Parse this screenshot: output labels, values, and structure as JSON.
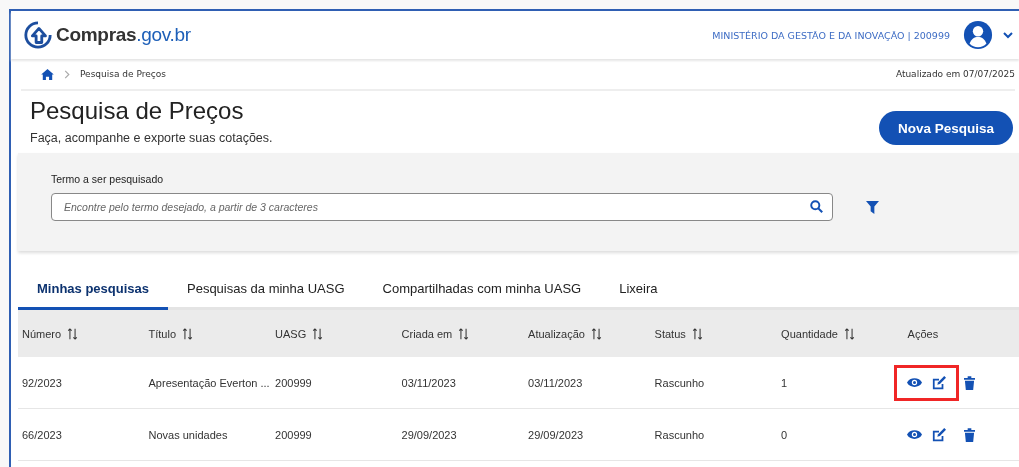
{
  "header": {
    "logo": {
      "name": "Compras",
      "suffix": ".gov.br"
    },
    "organization": "MINISTÉRIO DA GESTÃO E DA INOVAÇÃO | 200999"
  },
  "breadcrumb": {
    "items": [
      "Pesquisa de Preços"
    ],
    "updated": "Atualizado em 07/07/2025"
  },
  "page": {
    "title": "Pesquisa de Preços",
    "subtitle": "Faça, acompanhe e exporte suas cotações.",
    "primary_button": "Nova Pesquisa"
  },
  "search": {
    "label": "Termo a ser pesquisado",
    "placeholder": "Encontre pelo termo desejado, a partir de 3 caracteres"
  },
  "tabs": [
    {
      "label": "Minhas pesquisas",
      "selected": true
    },
    {
      "label": "Pesquisas da minha UASG",
      "selected": false
    },
    {
      "label": "Compartilhadas com minha UASG",
      "selected": false
    },
    {
      "label": "Lixeira",
      "selected": false
    }
  ],
  "table": {
    "columns": [
      {
        "label": "Número",
        "sortable": true
      },
      {
        "label": "Título",
        "sortable": true
      },
      {
        "label": "UASG",
        "sortable": true
      },
      {
        "label": "Criada em",
        "sortable": true
      },
      {
        "label": "Atualização",
        "sortable": true
      },
      {
        "label": "Status",
        "sortable": true
      },
      {
        "label": "Quantidade",
        "sortable": true
      },
      {
        "label": "Ações",
        "sortable": false
      }
    ],
    "rows": [
      {
        "cells": [
          "92/2023",
          "Apresentação Everton ...",
          "200999",
          "03/11/2023",
          "03/11/2023",
          "Rascunho",
          "1"
        ],
        "actions_highlighted": true
      },
      {
        "cells": [
          "66/2023",
          "Novas unidades",
          "200999",
          "29/09/2023",
          "29/09/2023",
          "Rascunho",
          "0"
        ],
        "actions_highlighted": false
      }
    ]
  }
}
